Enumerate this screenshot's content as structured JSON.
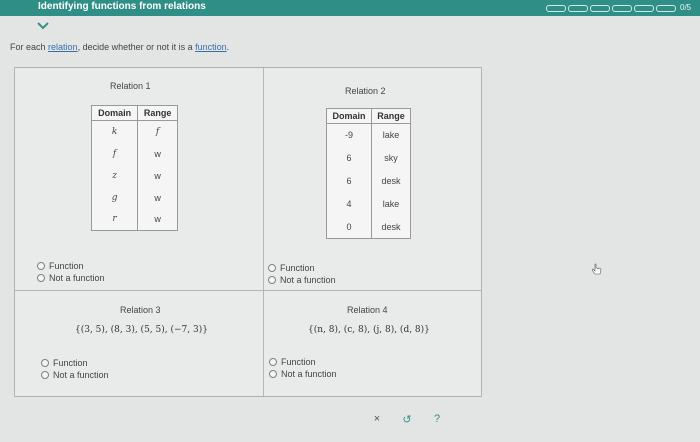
{
  "header": {
    "title": "Identifying functions from relations",
    "progress_label": "0/5"
  },
  "instruction": {
    "prefix": "For each ",
    "link1": "relation",
    "middle": ", decide whether or not it is a ",
    "link2": "function",
    "suffix": "."
  },
  "relation1": {
    "title": "Relation 1",
    "headers": [
      "Domain",
      "Range"
    ],
    "rows": [
      [
        "k",
        "f"
      ],
      [
        "f",
        "w"
      ],
      [
        "z",
        "w"
      ],
      [
        "g",
        "w"
      ],
      [
        "r",
        "w"
      ]
    ],
    "options": [
      "Function",
      "Not a function"
    ]
  },
  "relation2": {
    "title": "Relation 2",
    "headers": [
      "Domain",
      "Range"
    ],
    "rows": [
      [
        "-9",
        "lake"
      ],
      [
        "6",
        "sky"
      ],
      [
        "6",
        "desk"
      ],
      [
        "4",
        "lake"
      ],
      [
        "0",
        "desk"
      ]
    ],
    "options": [
      "Function",
      "Not a function"
    ]
  },
  "relation3": {
    "title": "Relation 3",
    "set": "{(3, 5), (8, 3), (5, 5), (−7, 3)}",
    "options": [
      "Function",
      "Not a function"
    ]
  },
  "relation4": {
    "title": "Relation 4",
    "set": "{(n, 8), (c, 8), (j, 8), (d, 8)}",
    "options": [
      "Function",
      "Not a function"
    ]
  },
  "actions": {
    "clear": "×",
    "undo": "↺",
    "help": "?"
  },
  "colors": {
    "header_bg": "#2f8f86",
    "accent": "#3a8f86",
    "link": "#3a6fa8"
  }
}
